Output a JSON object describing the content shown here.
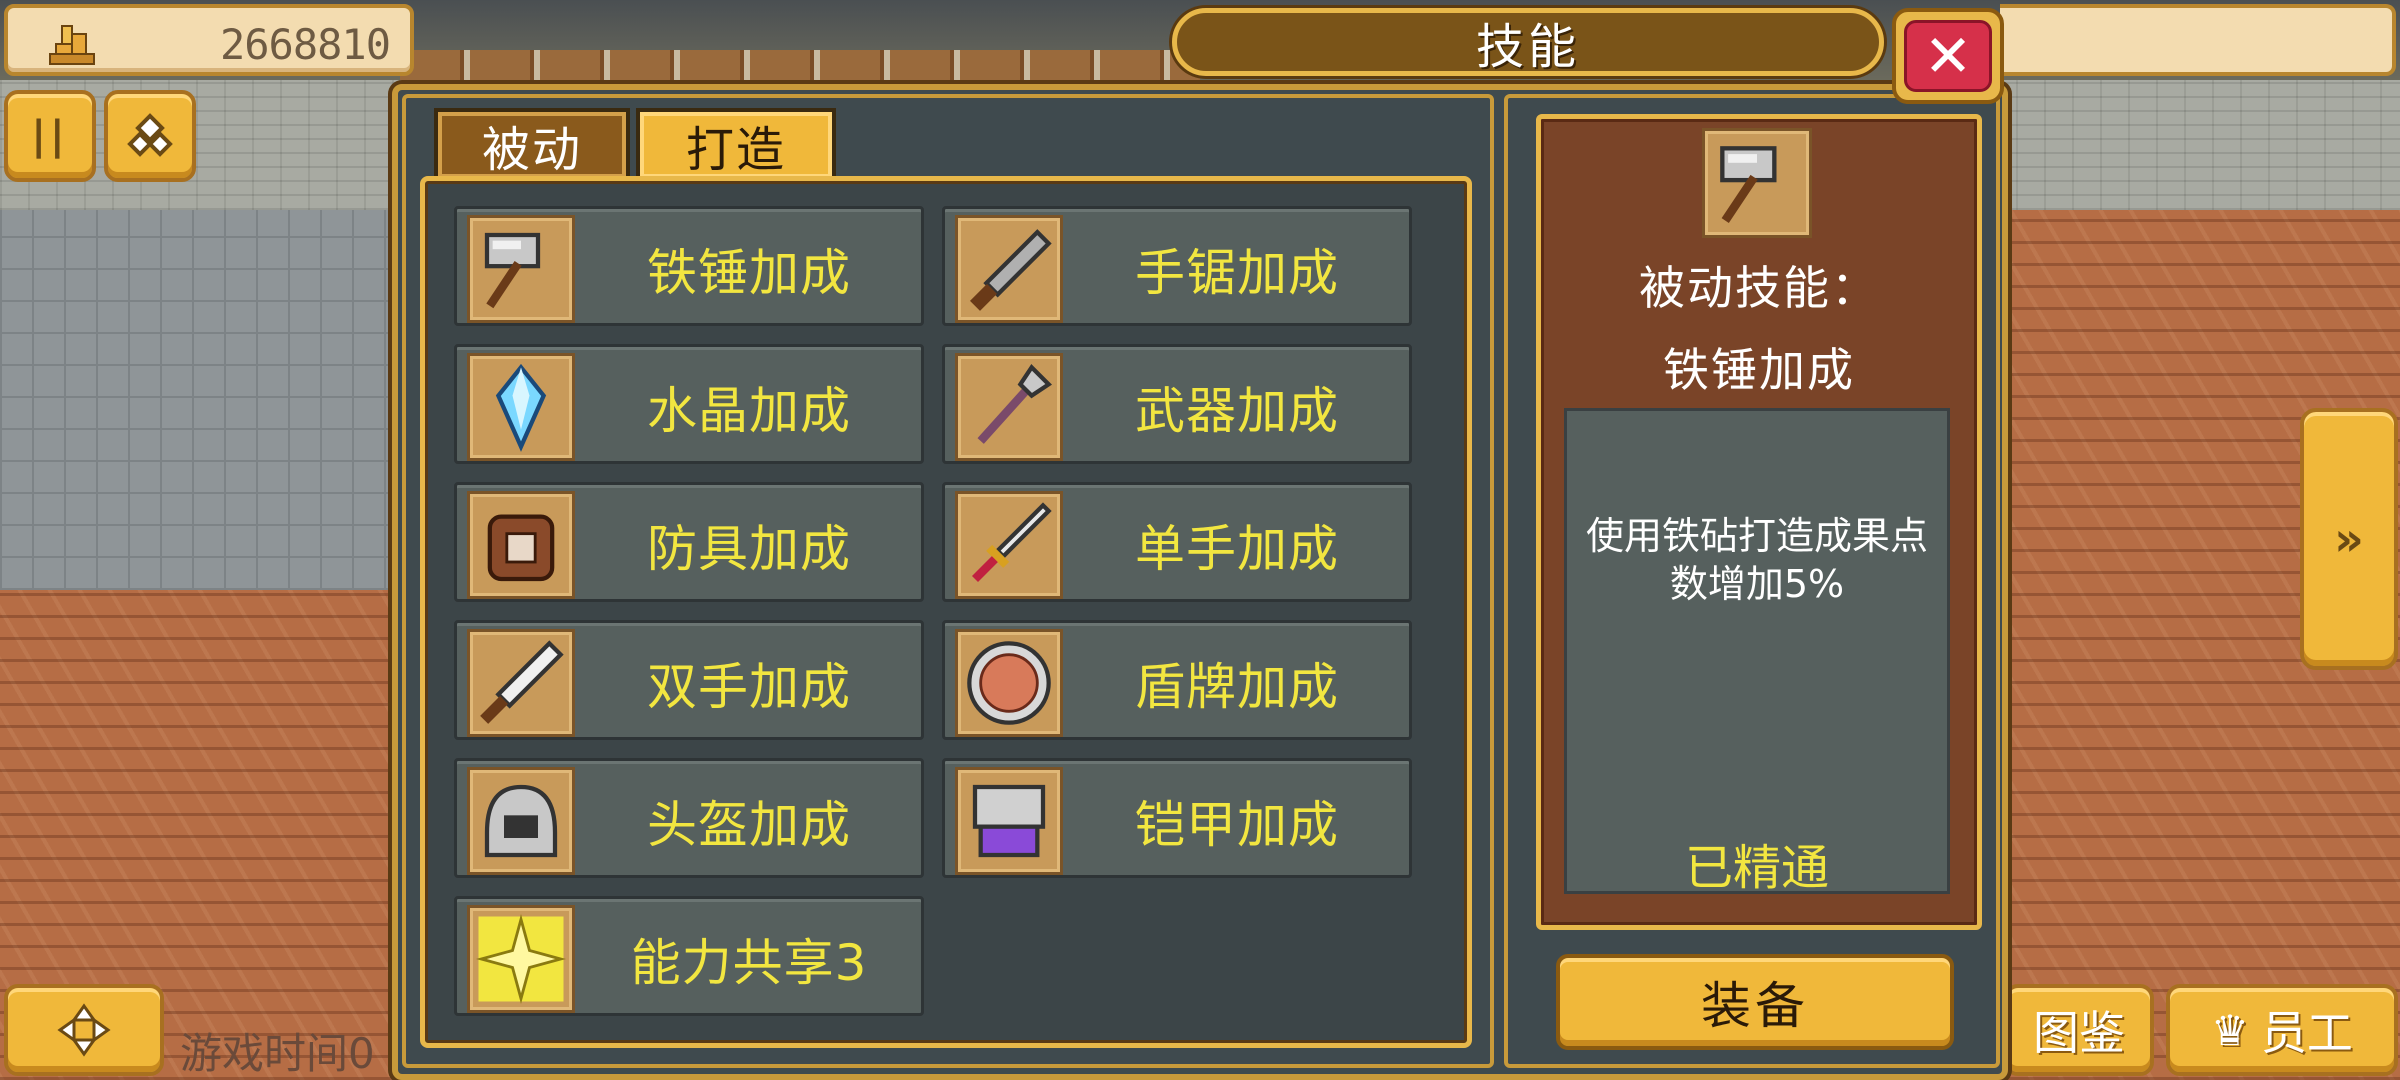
{
  "hud": {
    "money_value": "2668810",
    "money_icon": "coin-stack-icon",
    "pause_icon": "pause-icon",
    "gems_icon": "gems-icon",
    "move_icon": "move-cross-icon",
    "game_time_label": "游戏时间0",
    "side_arrow_icon": "fast-forward-icon",
    "codex_label": "图鉴",
    "staff_label": "员工",
    "staff_icon": "crown-icon"
  },
  "modal": {
    "title": "技能",
    "close_icon": "close-icon",
    "tabs": [
      {
        "label": "被动",
        "selected": false
      },
      {
        "label": "打造",
        "selected": true
      }
    ]
  },
  "skills": [
    {
      "label": "铁锤加成",
      "icon": "hammer-icon"
    },
    {
      "label": "手锯加成",
      "icon": "handsaw-icon"
    },
    {
      "label": "水晶加成",
      "icon": "crystal-icon"
    },
    {
      "label": "武器加成",
      "icon": "spear-icon"
    },
    {
      "label": "防具加成",
      "icon": "armor-bag-icon"
    },
    {
      "label": "单手加成",
      "icon": "dagger-icon"
    },
    {
      "label": "双手加成",
      "icon": "greatsword-icon"
    },
    {
      "label": "盾牌加成",
      "icon": "shield-icon"
    },
    {
      "label": "头盔加成",
      "icon": "helmet-icon"
    },
    {
      "label": "铠甲加成",
      "icon": "chestplate-icon"
    },
    {
      "label": "能力共享3",
      "icon": "sunburst-icon"
    }
  ],
  "detail": {
    "icon": "hammer-icon",
    "type_label": "被动技能：",
    "name": "铁锤加成",
    "description": "使用铁砧打造成果点数增加5%",
    "status": "已精通",
    "equip_label": "装备"
  },
  "colors": {
    "accent_gold": "#f0b83a",
    "skill_label_yellow": "#f2e640",
    "close_red": "#d6304a",
    "panel_dark": "#3f4a4e"
  }
}
